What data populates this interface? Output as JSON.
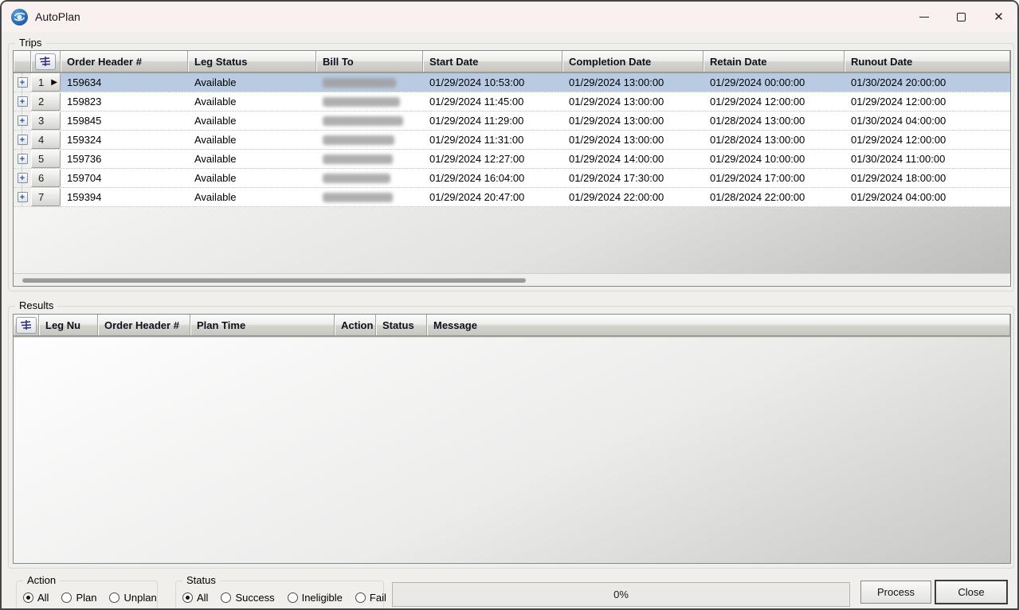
{
  "window": {
    "title": "AutoPlan",
    "controls": {
      "minimize": "minimize",
      "maximize": "maximize",
      "close": "✕"
    }
  },
  "trips": {
    "group_label": "Trips",
    "columns": [
      "Order Header #",
      "Leg Status",
      "Bill To",
      "Start Date",
      "Completion Date",
      "Retain Date",
      "Runout Date"
    ],
    "rows": [
      {
        "num": "1",
        "order_header": "159634",
        "leg_status": "Available",
        "bill_to_redacted": true,
        "blur_width": 92,
        "start": "01/29/2024 10:53:00",
        "completion": "01/29/2024 13:00:00",
        "retain": "01/29/2024 00:00:00",
        "runout": "01/30/2024 20:00:00",
        "selected": true
      },
      {
        "num": "2",
        "order_header": "159823",
        "leg_status": "Available",
        "bill_to_redacted": true,
        "blur_width": 97,
        "start": "01/29/2024 11:45:00",
        "completion": "01/29/2024 13:00:00",
        "retain": "01/29/2024 12:00:00",
        "runout": "01/29/2024 12:00:00",
        "selected": false
      },
      {
        "num": "3",
        "order_header": "159845",
        "leg_status": "Available",
        "bill_to_redacted": true,
        "blur_width": 101,
        "start": "01/29/2024 11:29:00",
        "completion": "01/29/2024 13:00:00",
        "retain": "01/28/2024 13:00:00",
        "runout": "01/30/2024 04:00:00",
        "selected": false
      },
      {
        "num": "4",
        "order_header": "159324",
        "leg_status": "Available",
        "bill_to_redacted": true,
        "blur_width": 90,
        "start": "01/29/2024 11:31:00",
        "completion": "01/29/2024 13:00:00",
        "retain": "01/28/2024 13:00:00",
        "runout": "01/29/2024 12:00:00",
        "selected": false
      },
      {
        "num": "5",
        "order_header": "159736",
        "leg_status": "Available",
        "bill_to_redacted": true,
        "blur_width": 88,
        "start": "01/29/2024 12:27:00",
        "completion": "01/29/2024 14:00:00",
        "retain": "01/29/2024 10:00:00",
        "runout": "01/30/2024 11:00:00",
        "selected": false
      },
      {
        "num": "6",
        "order_header": "159704",
        "leg_status": "Available",
        "bill_to_redacted": true,
        "blur_width": 85,
        "start": "01/29/2024 16:04:00",
        "completion": "01/29/2024 17:30:00",
        "retain": "01/29/2024 17:00:00",
        "runout": "01/29/2024 18:00:00",
        "selected": false
      },
      {
        "num": "7",
        "order_header": "159394",
        "leg_status": "Available",
        "bill_to_redacted": true,
        "blur_width": 88,
        "start": "01/29/2024 20:47:00",
        "completion": "01/29/2024 22:00:00",
        "retain": "01/28/2024 22:00:00",
        "runout": "01/29/2024 04:00:00",
        "selected": false
      }
    ]
  },
  "results": {
    "group_label": "Results",
    "columns": [
      "Leg Nu",
      "Order Header #",
      "Plan Time",
      "Action",
      "Status",
      "Message"
    ],
    "rows": []
  },
  "filters": {
    "action": {
      "label": "Action",
      "options": [
        "All",
        "Plan",
        "Unplan"
      ],
      "selected": "All"
    },
    "status": {
      "label": "Status",
      "options": [
        "All",
        "Success",
        "Ineligible",
        "Fail"
      ],
      "selected": "All"
    }
  },
  "progress": {
    "value": "0%"
  },
  "buttons": {
    "process": "Process",
    "close": "Close"
  },
  "icons": {
    "app": "autoplan-logo",
    "filter": "filter-rows-icon",
    "expand_glyph": "+",
    "active_marker": "▶"
  },
  "colors": {
    "titlebar": "#f9f1ef",
    "selected_row": "#b9cbe2",
    "header_text": "#10101e"
  }
}
